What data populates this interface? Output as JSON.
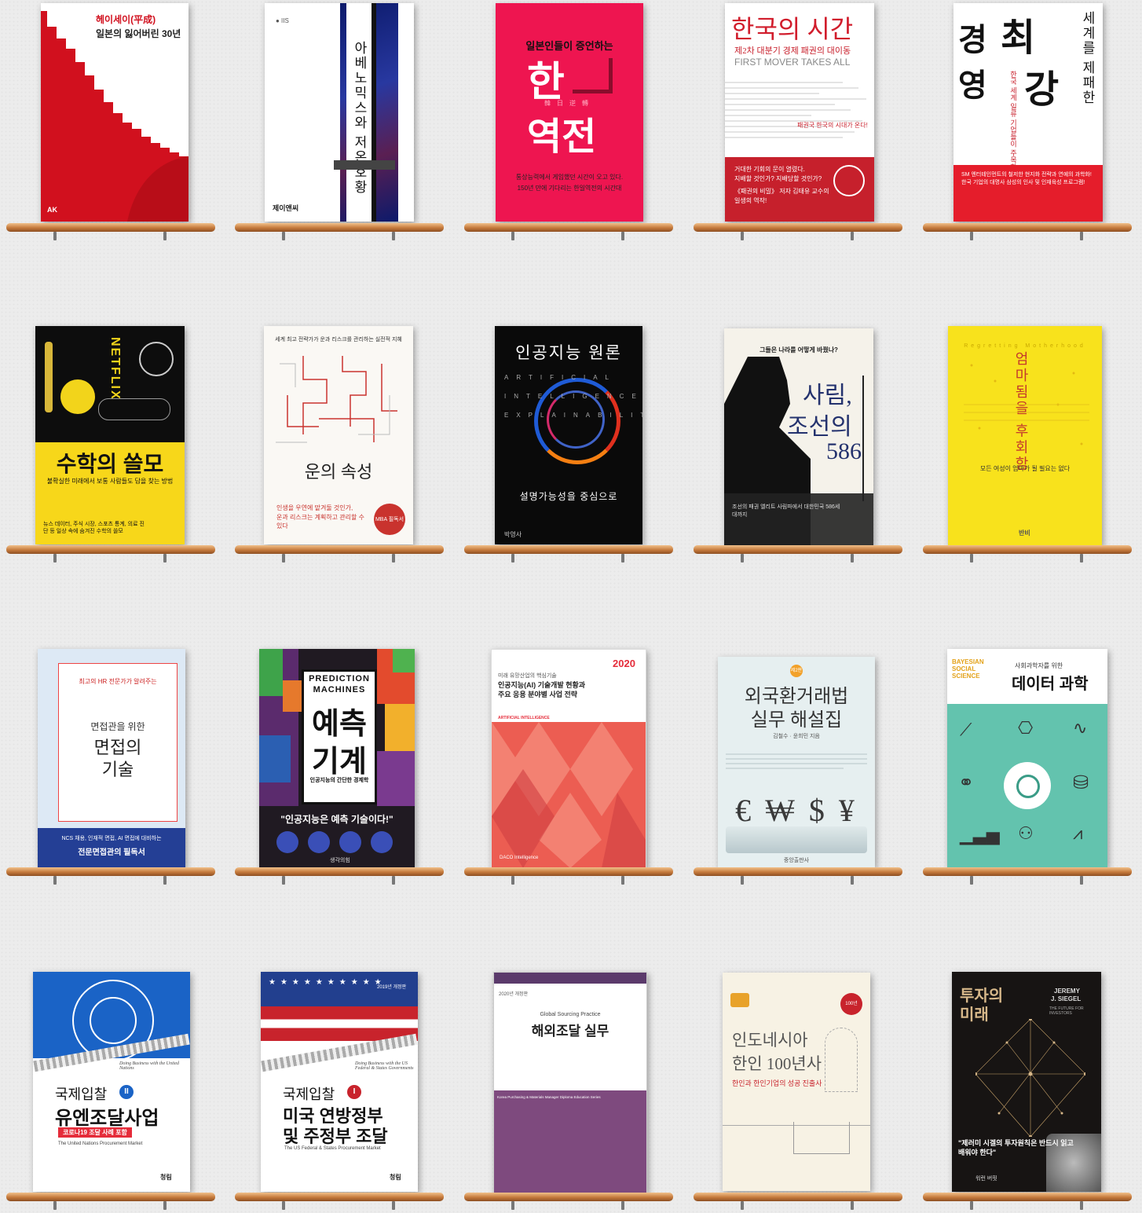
{
  "books": {
    "b1": {
      "title": "헤이세이(平成)",
      "subtitle": "일본의 잃어버린 30년",
      "publisher": "AK"
    },
    "b2": {
      "title": "아베노믹스와 저온호황",
      "publisher": "제이앤씨"
    },
    "b3": {
      "top": "일본인들이 증언하는",
      "title1": "한",
      "title2": "역전",
      "hanja": "韓日逆轉",
      "desc1": "통상능력에서 게임했던 시간이 오고 있다.",
      "desc2": "150년 만에 기다리는 한일역전의 시간대"
    },
    "b4": {
      "title": "한국의 시간",
      "subtitle": "제2차 대분기 경제 패권의 대이동",
      "english": "FIRST MOVER TAKES ALL",
      "tagline": "패권국 한국의 시대가 온다!",
      "body1": "거대한 기회의 문이 열렸다.",
      "body2": "지배할 것인가? 지배당할 것인가?",
      "body3": "《패권의 비밀》 저자 김태유 교수의",
      "body4": "일생의 역작!"
    },
    "b5": {
      "title1": "최",
      "title2": "강",
      "title3": "경",
      "title4": "영",
      "side": "세계를 제패한",
      "sub": "한국 세계 일류 기업들이 주목한",
      "body": "SM 엔터테인먼트의 철저한 현지화 전략과 연예의 과학화! 한국 기업의 대명사 삼성의 인사 및 인재육성 프로그램!"
    },
    "b6": {
      "brand": "NETFLIX",
      "title": "수학의 쓸모",
      "subtitle": "불확실한 미래에서 보통 사람들도 답을 찾는 방법",
      "footer": "뉴스 데이터, 주식 시장, 스포츠 통계, 의료 진단 등 일상 속에 숨겨진 수학의 쓸모"
    },
    "b7": {
      "top": "세계 최고 전략가가 운과 리스크를 관리하는 실전적 지혜",
      "title": "운의 속성",
      "quote1": "인생을 우연에 맡겨둘 것인가,",
      "quote2": "운과 리스크는 계획하고 관리할 수 있다",
      "badge": "MBA 필독서"
    },
    "b8": {
      "title": "인공지능 원론",
      "letters": "ARTIFICIAL INTELLIGENCE EXPLAINABILITY",
      "subtitle": "설명가능성을 중심으로",
      "publisher": "박영사"
    },
    "b9": {
      "top": "그들은 나라를 어떻게 바꿨나?",
      "title1": "사림,",
      "title2": "조선의",
      "title3": "586",
      "body": "조선의 패권 엘리트 사림파에서 대한민국 586세대까지"
    },
    "b10": {
      "title": "엄마됨을 후회함",
      "english": "Regretting Motherhood",
      "sub": "모든 여성이 엄마가 될 필요는 없다",
      "publisher": "반비"
    },
    "b11": {
      "top": "최고의 HR 전문가가 알려주는",
      "title1": "면접관을 위한",
      "title2": "면접의",
      "title3": "기술",
      "footer1": "NCS 채용, 인재적 면접, AI 면접에 대비하는",
      "footer2": "전문면접관의 필독서"
    },
    "b12": {
      "english1": "PREDICTION",
      "english2": "MACHINES",
      "title1": "예측",
      "title2": "기계",
      "subtitle": "인공지능의 간단한 경제학",
      "quote": "\"인공지능은 예측 기술이다!\"",
      "publisher": "생각의힘"
    },
    "b13": {
      "top": "미래 유망산업의 핵심기술",
      "title1": "인공지능(AI) 기술개발 현황과",
      "title2": "주요 응용 분야별 사업 전략",
      "year": "2020",
      "english": "ARTIFICIAL INTELLIGENCE",
      "publisher": "DACO Intelligence"
    },
    "b14": {
      "edition": "제2판",
      "title1": "외국환거래법",
      "title2": "실무 해설집",
      "authors": "김철수 · 윤희민 지음",
      "symbols": "€ ₩ $ ¥",
      "publisher": "중앙출판사"
    },
    "b15": {
      "english1": "BAYESIAN",
      "english2": "SOCIAL",
      "english3": "SCIENCE",
      "top": "사회과학자를 위한",
      "title": "데이터 과학"
    },
    "b16": {
      "prefix": "국제입찰",
      "numeral": "II",
      "title": "유엔조달사업",
      "badge": "코로나19 조달 사례 포함",
      "english": "The United Nations Procurement Market",
      "script": "Doing Business with the United Nations",
      "publisher": "청림"
    },
    "b17": {
      "edition": "2019년 개정판",
      "prefix": "국제입찰",
      "numeral": "I",
      "title1": "미국 연방정부",
      "title2": "및 주정부 조달",
      "english": "The US Federal & States Procurement Market",
      "script": "Doing Business with the US Federal & States Governments",
      "publisher": "청림"
    },
    "b18": {
      "edition": "2020년 개정판",
      "english": "Global Sourcing Practice",
      "title": "해외조달 실무",
      "series": "Korea Purchasing & Materials Manager Diploma Education Series"
    },
    "b19": {
      "title1": "인도네시아",
      "title2": "한인 100년사",
      "subtitle": "한인과 한인기업의 성공 진출사",
      "badge": "100년"
    },
    "b20": {
      "title1": "투자의",
      "title2": "미래",
      "author1": "JEREMY",
      "author2": "J. SIEGEL",
      "english": "THE FUTURE FOR INVESTORS",
      "quote": "\"제러미 시겔의 투자원칙은 반드시 읽고 배워야 한다\"",
      "quote_by": "워런 버핏"
    }
  },
  "colors": {
    "shelf": "#c57a3c",
    "red": "#d0102b",
    "yellow": "#f8e21c",
    "teal": "#63c3ae",
    "purple": "#7e4a7e",
    "navy": "#243f95"
  }
}
